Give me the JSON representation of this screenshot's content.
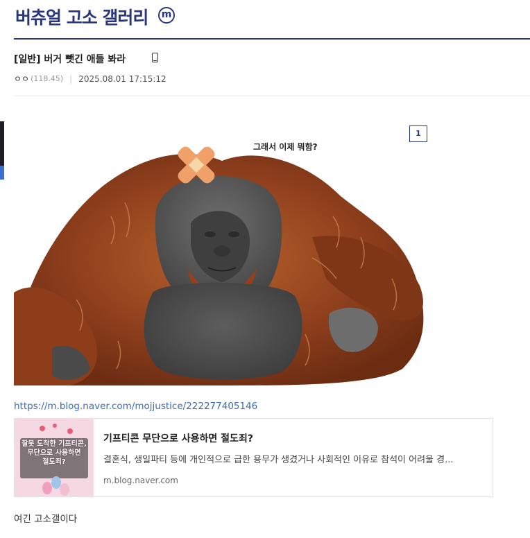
{
  "gallery": {
    "title": "버츄얼 고소 갤러리",
    "badge": "m"
  },
  "post": {
    "title": "[일반] 버거 뺏긴 애들 봐라",
    "writer": "ㅇㅇ",
    "writer_ip": "(118.45)",
    "separator": "|",
    "date": "2025.08.01 17:15:12"
  },
  "image": {
    "number_label": "1",
    "caption": "그래서 이제 뭐함?"
  },
  "link_preview": {
    "url": "https://m.blog.naver.com/mojjustice/222277405146",
    "title": "기프티콘 무단으로 사용하면 절도죄?",
    "description": "결혼식, 생일파티 등에 개인적으로 급한 용무가 생겼거나 사회적인 이유로 참석이 어려울 경...",
    "domain": "m.blog.naver.com",
    "thumb_lines": [
      "잘못 도착한 기프티콘,",
      "무단으로 사용하면",
      "절도죄?"
    ]
  },
  "body_text": "여긴 고소갤이다",
  "colors": {
    "brand": "#29367c",
    "link": "#3b6db3"
  }
}
